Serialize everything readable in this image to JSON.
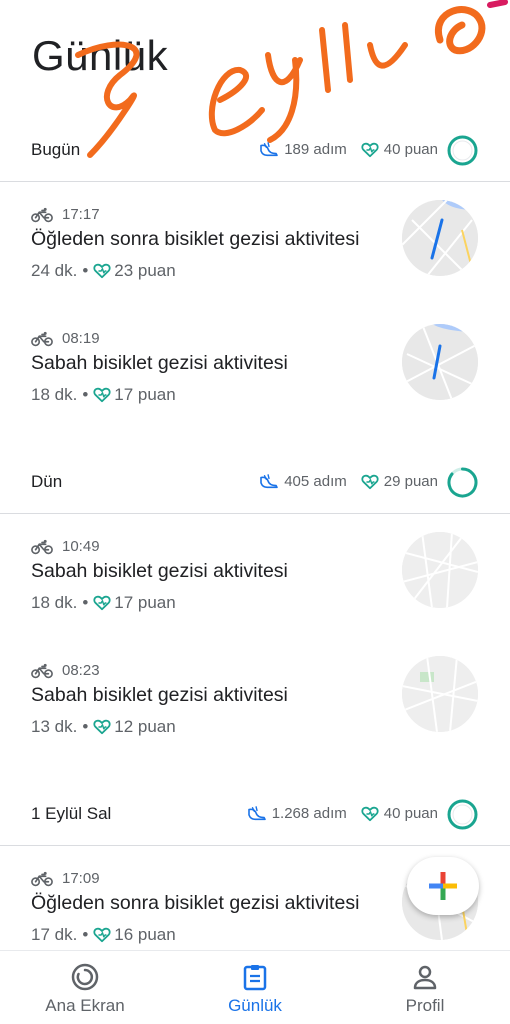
{
  "page": {
    "title": "Günlük"
  },
  "colors": {
    "accent": "#1a73e8",
    "heart_points": "#1aa590",
    "ring": "#1aa590",
    "scribble": "#f26b1d"
  },
  "days": [
    {
      "label": "Bugün",
      "steps": "189 adım",
      "points": "40 puan"
    },
    {
      "label": "Dün",
      "steps": "405 adım",
      "points": "29 puan"
    },
    {
      "label": "1 Eylül Sal",
      "steps": "1.268 adım",
      "points": "40 puan"
    }
  ],
  "activities": [
    {
      "time": "17:17",
      "title": "Öğleden sonra bisiklet gezisi aktivitesi",
      "duration": "24 dk.",
      "points": "23 puan",
      "icon": "bike-icon"
    },
    {
      "time": "08:19",
      "title": "Sabah bisiklet gezisi aktivitesi",
      "duration": "18 dk.",
      "points": "17 puan",
      "icon": "bike-icon"
    },
    {
      "time": "10:49",
      "title": "Sabah bisiklet gezisi aktivitesi",
      "duration": "18 dk.",
      "points": "17 puan",
      "icon": "bike-icon"
    },
    {
      "time": "08:23",
      "title": "Sabah bisiklet gezisi aktivitesi",
      "duration": "13 dk.",
      "points": "12 puan",
      "icon": "bike-icon"
    },
    {
      "time": "17:09",
      "title": "Öğleden sonra bisiklet gezisi aktivitesi",
      "duration": "17 dk.",
      "points": "16 puan",
      "icon": "bike-icon"
    }
  ],
  "bottom_nav": [
    {
      "label": "Ana Ekran",
      "icon": "home-ring-icon",
      "active": false
    },
    {
      "label": "Günlük",
      "icon": "clipboard-icon",
      "active": true
    },
    {
      "label": "Profil",
      "icon": "person-icon",
      "active": false
    }
  ],
  "fab": {
    "icon": "plus-icon"
  }
}
